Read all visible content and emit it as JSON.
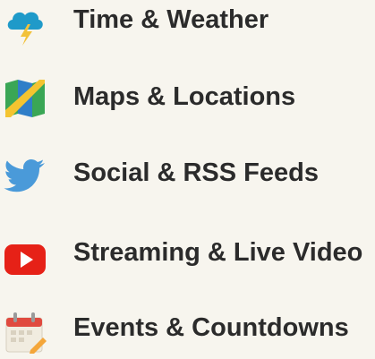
{
  "menu": {
    "items": [
      {
        "label": "Time & Weather",
        "icon": "cloud-lightning-icon"
      },
      {
        "label": "Maps & Locations",
        "icon": "map-icon"
      },
      {
        "label": "Social & RSS Feeds",
        "icon": "twitter-bird-icon"
      },
      {
        "label": "Streaming & Live Video",
        "icon": "youtube-play-icon"
      },
      {
        "label": "Events & Countdowns",
        "icon": "calendar-pencil-icon"
      }
    ]
  },
  "colors": {
    "background": "#f7f5ee",
    "text": "#2b2b2b",
    "cloud": "#1f9ac9",
    "bolt": "#f2c23a",
    "map_green": "#3aa655",
    "map_blue": "#2f7ec8",
    "map_yellow": "#f4c430",
    "twitter_blue": "#4a9ad9",
    "youtube_red": "#e62117",
    "calendar_red": "#e04a3f"
  }
}
